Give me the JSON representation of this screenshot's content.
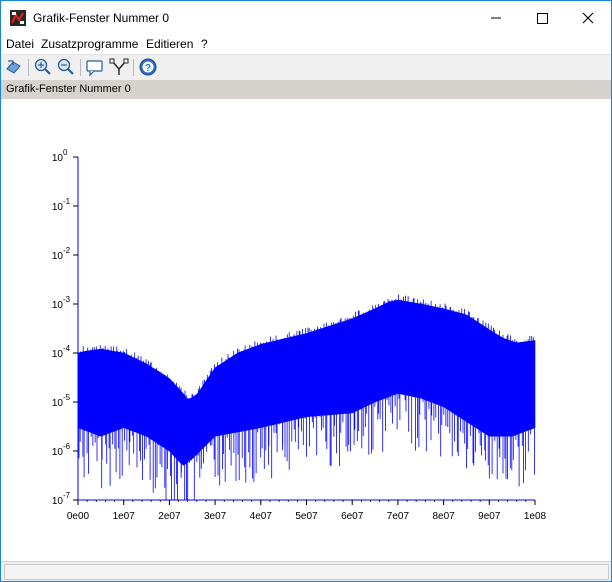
{
  "window": {
    "title": "Grafik-Fenster Nummer 0",
    "controls": [
      "minimize-icon",
      "maximize-icon",
      "close-icon"
    ]
  },
  "menu": {
    "items": [
      "Datei",
      "Zusatzprogramme",
      "Editieren",
      "?"
    ]
  },
  "toolbar": {
    "icons": [
      "rotate-icon",
      "zoom-in-icon",
      "zoom-out-icon",
      "datatip-icon",
      "datatip-manager-icon",
      "help-icon"
    ]
  },
  "info_strip": {
    "text": "Grafik-Fenster Nummer 0"
  },
  "status_bar": {
    "text": ""
  },
  "colors": {
    "series": "#0000ff",
    "window_border": "#1883d7"
  },
  "chart_data": {
    "type": "area",
    "title": "",
    "xlabel": "",
    "ylabel": "",
    "x_scale": "linear",
    "y_scale": "log",
    "xlim": [
      0,
      100000000
    ],
    "ylim": [
      1e-07,
      1
    ],
    "grid": false,
    "legend": "none",
    "x_ticks": [
      {
        "value": 0,
        "label": "0e00"
      },
      {
        "value": 10000000,
        "label": "1e07"
      },
      {
        "value": 20000000,
        "label": "2e07"
      },
      {
        "value": 30000000,
        "label": "3e07"
      },
      {
        "value": 40000000,
        "label": "4e07"
      },
      {
        "value": 50000000,
        "label": "5e07"
      },
      {
        "value": 60000000,
        "label": "6e07"
      },
      {
        "value": 70000000,
        "label": "7e07"
      },
      {
        "value": 80000000,
        "label": "8e07"
      },
      {
        "value": 90000000,
        "label": "9e07"
      },
      {
        "value": 100000000,
        "label": "1e08"
      }
    ],
    "y_ticks": [
      {
        "value": 1e-07,
        "base": "10",
        "exp": "-7"
      },
      {
        "value": 1e-06,
        "base": "10",
        "exp": "-6"
      },
      {
        "value": 1e-05,
        "base": "10",
        "exp": "-5"
      },
      {
        "value": 0.0001,
        "base": "10",
        "exp": "-4"
      },
      {
        "value": 0.001,
        "base": "10",
        "exp": "-3"
      },
      {
        "value": 0.01,
        "base": "10",
        "exp": "-2"
      },
      {
        "value": 0.1,
        "base": "10",
        "exp": "-1"
      },
      {
        "value": 1,
        "base": "10",
        "exp": "0"
      }
    ],
    "series": [
      {
        "color": "#0000ff",
        "upper_envelope": {
          "x": [
            0,
            2000000,
            5000000,
            10000000,
            15000000,
            20000000,
            23000000,
            24000000,
            26000000,
            30000000,
            35000000,
            40000000,
            50000000,
            60000000,
            65000000,
            68000000,
            70000000,
            75000000,
            80000000,
            85000000,
            90000000,
            93000000,
            96000000,
            100000000
          ],
          "y": [
            0.0001,
            0.00011,
            0.00012,
            0.0001,
            6e-05,
            3e-05,
            1.5e-05,
            1.1e-05,
            1.4e-05,
            5e-05,
            0.0001,
            0.00015,
            0.00025,
            0.0005,
            0.0008,
            0.0011,
            0.0012,
            0.001,
            0.0008,
            0.0006,
            0.0003,
            0.0002,
            0.00016,
            0.00018
          ]
        },
        "lower_envelope": {
          "x": [
            0,
            5000000,
            10000000,
            15000000,
            20000000,
            23000000,
            25000000,
            30000000,
            40000000,
            50000000,
            60000000,
            65000000,
            70000000,
            75000000,
            80000000,
            85000000,
            90000000,
            95000000,
            100000000
          ],
          "y": [
            3e-06,
            2e-06,
            3e-06,
            2e-06,
            1e-06,
            5e-07,
            7e-07,
            2e-06,
            3e-06,
            5e-06,
            6e-06,
            1e-05,
            1.5e-05,
            1.2e-05,
            8e-06,
            4e-06,
            2e-06,
            2e-06,
            3e-06
          ]
        }
      }
    ]
  }
}
